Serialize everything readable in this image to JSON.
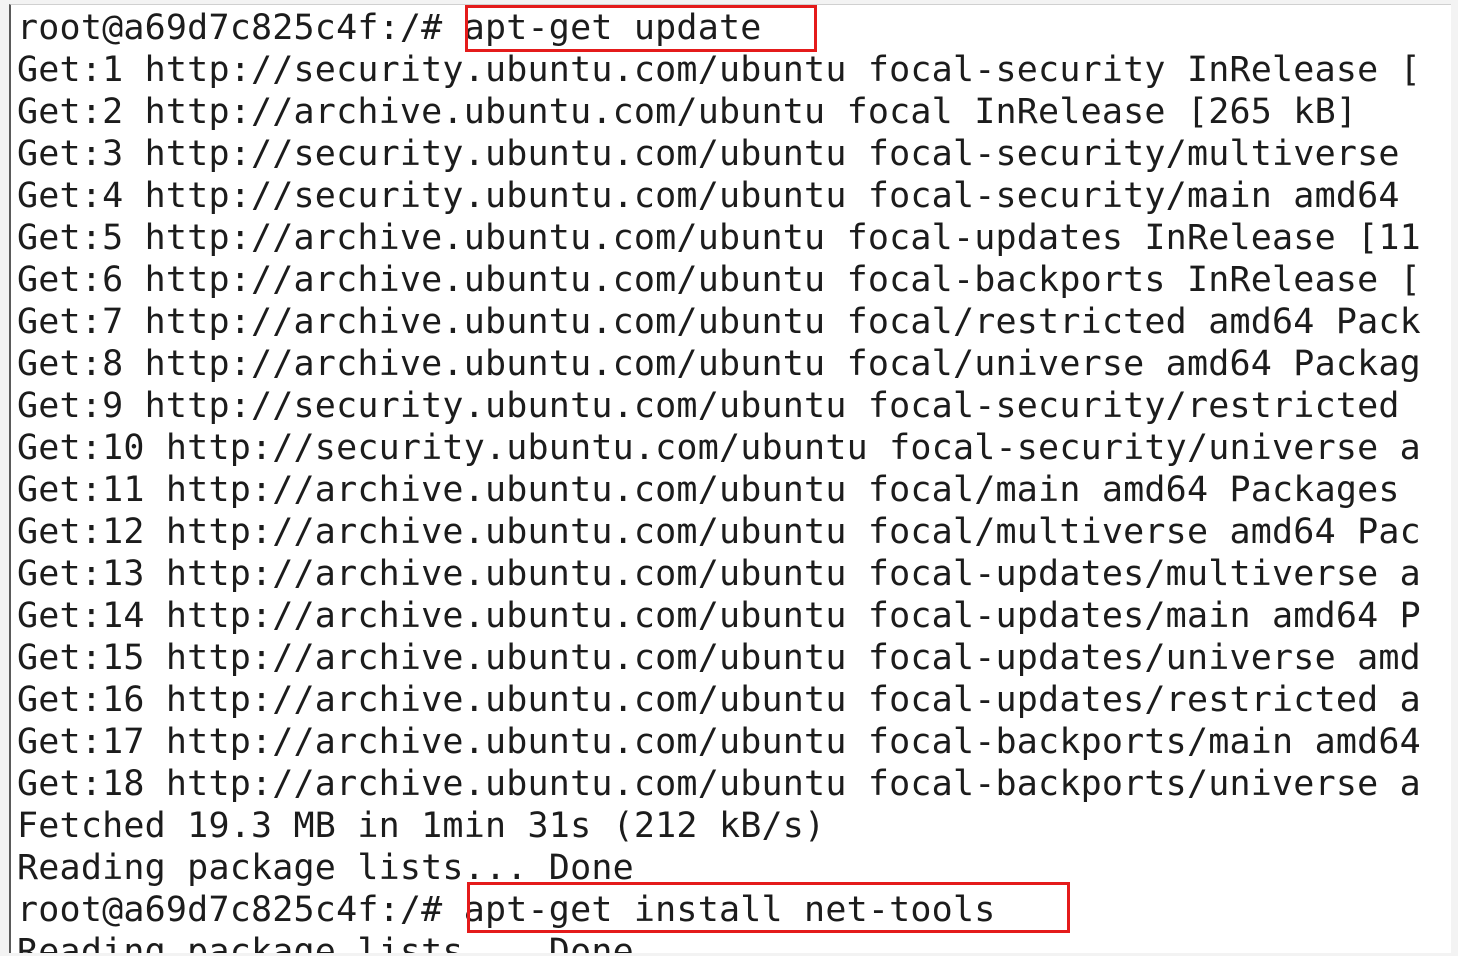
{
  "terminal": {
    "lines": [
      "root@a69d7c825c4f:/# apt-get update",
      "Get:1 http://security.ubuntu.com/ubuntu focal-security InRelease [",
      "Get:2 http://archive.ubuntu.com/ubuntu focal InRelease [265 kB]",
      "Get:3 http://security.ubuntu.com/ubuntu focal-security/multiverse",
      "Get:4 http://security.ubuntu.com/ubuntu focal-security/main amd64",
      "Get:5 http://archive.ubuntu.com/ubuntu focal-updates InRelease [11",
      "Get:6 http://archive.ubuntu.com/ubuntu focal-backports InRelease [",
      "Get:7 http://archive.ubuntu.com/ubuntu focal/restricted amd64 Pack",
      "Get:8 http://archive.ubuntu.com/ubuntu focal/universe amd64 Packag",
      "Get:9 http://security.ubuntu.com/ubuntu focal-security/restricted",
      "Get:10 http://security.ubuntu.com/ubuntu focal-security/universe a",
      "Get:11 http://archive.ubuntu.com/ubuntu focal/main amd64 Packages",
      "Get:12 http://archive.ubuntu.com/ubuntu focal/multiverse amd64 Pac",
      "Get:13 http://archive.ubuntu.com/ubuntu focal-updates/multiverse a",
      "Get:14 http://archive.ubuntu.com/ubuntu focal-updates/main amd64 P",
      "Get:15 http://archive.ubuntu.com/ubuntu focal-updates/universe amd",
      "Get:16 http://archive.ubuntu.com/ubuntu focal-updates/restricted a",
      "Get:17 http://archive.ubuntu.com/ubuntu focal-backports/main amd64",
      "Get:18 http://archive.ubuntu.com/ubuntu focal-backports/universe a",
      "Fetched 19.3 MB in 1min 31s (212 kB/s)",
      "Reading package lists... Done",
      "root@a69d7c825c4f:/# apt-get install net-tools",
      "Reading package lists... Done"
    ],
    "highlight_color": "#e41b1b"
  }
}
